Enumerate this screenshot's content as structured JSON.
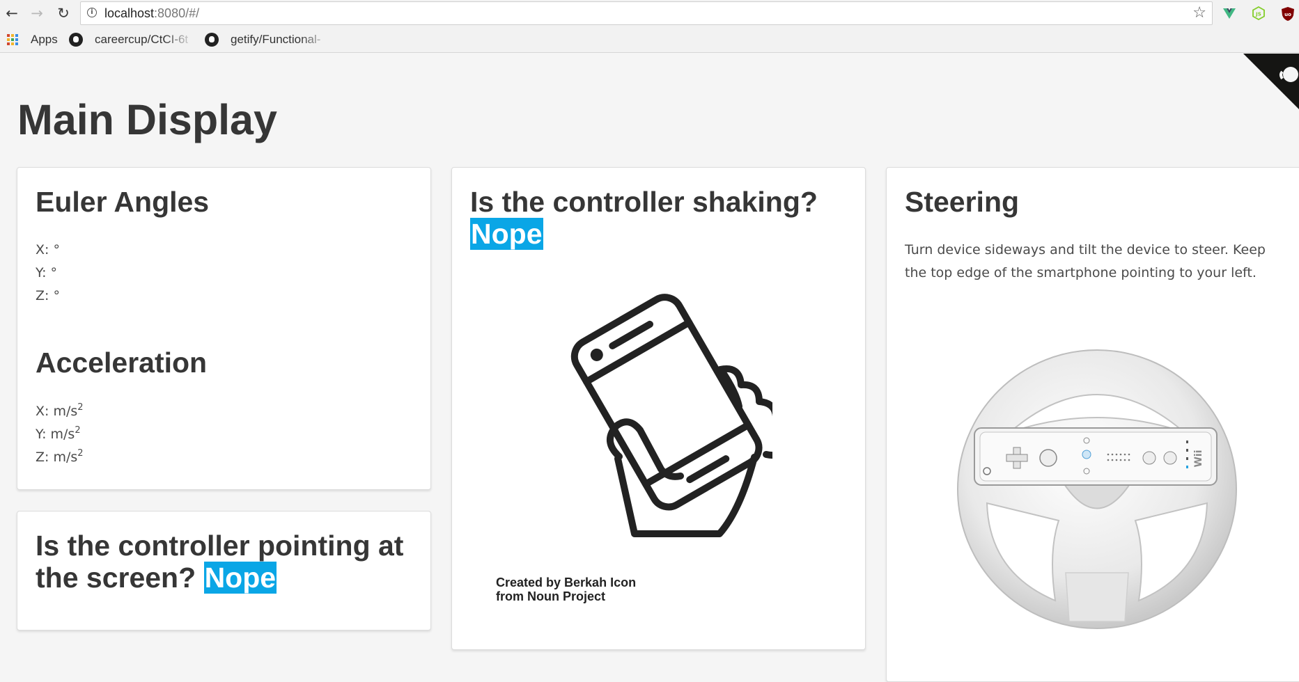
{
  "browser": {
    "url_host": "localhost",
    "url_rest": ":8080/#/",
    "bookmarks": {
      "apps": "Apps",
      "items": [
        "careercup/CtCI-6t",
        "getify/Functional-"
      ]
    }
  },
  "page": {
    "title": "Main Display"
  },
  "euler": {
    "heading": "Euler Angles",
    "x": "X: °",
    "y": "Y: °",
    "z": "Z: °"
  },
  "acceleration": {
    "heading": "Acceleration",
    "x": "X: m/s",
    "y": "Y: m/s",
    "z": "Z: m/s",
    "exponent": "2"
  },
  "pointing": {
    "question": "Is the controller pointing at the screen?",
    "answer": "Nope"
  },
  "shaking": {
    "question": "Is the controller shaking?",
    "answer": "Nope",
    "credit_line1": "Created by Berkah Icon",
    "credit_line2": "from Noun Project"
  },
  "steering": {
    "heading": "Steering",
    "description": "Turn device sideways and tilt the device to steer. Keep the top edge of the smartphone pointing to your left.",
    "wheel_logo": "Wii"
  },
  "colors": {
    "highlight": "#0aa6e6",
    "background": "#f5f5f5",
    "card": "#ffffff"
  }
}
